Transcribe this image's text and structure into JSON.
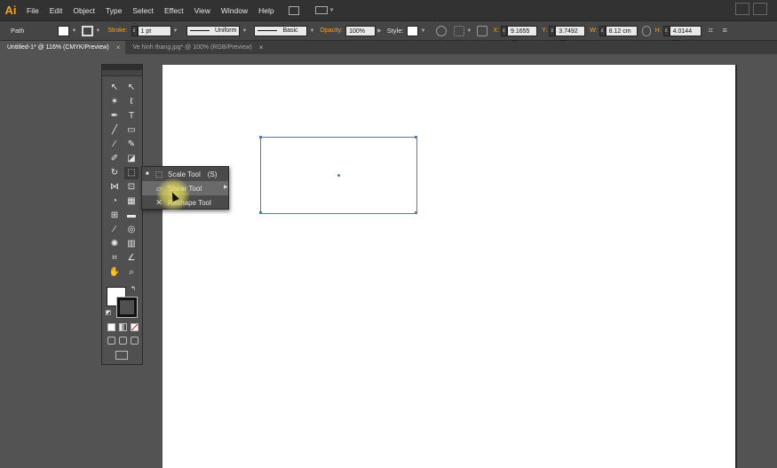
{
  "app": {
    "logo": "Ai"
  },
  "menu": {
    "items": [
      "File",
      "Edit",
      "Object",
      "Type",
      "Select",
      "Effect",
      "View",
      "Window",
      "Help"
    ]
  },
  "control_bar": {
    "selection_label": "Path",
    "fill_color": "#ffffff",
    "stroke_label": "Stroke:",
    "stroke_weight": "1 pt",
    "profile": "Uniform",
    "brush": "Basic",
    "opacity_label": "Opacity:",
    "opacity_value": "100%",
    "style_label": "Style:",
    "x_label": "X:",
    "x_value": "9.1655 cm",
    "y_label": "Y:",
    "y_value": "3.7492 cm",
    "w_label": "W:",
    "w_value": "8.12 cm",
    "h_label": "H:",
    "h_value": "4.0144 cm"
  },
  "tabs": [
    {
      "label": "Untitled-1* @ 116% (CMYK/Preview)",
      "active": true
    },
    {
      "label": "Ve hinh thang.jpg* @ 100% (RGB/Preview)",
      "active": false
    }
  ],
  "flyout": {
    "items": [
      {
        "label": "Scale Tool",
        "shortcut": "(S)",
        "icon": "scale-icon"
      },
      {
        "label": "Shear Tool",
        "shortcut": "",
        "icon": "shear-icon"
      },
      {
        "label": "Reshape Tool",
        "shortcut": "",
        "icon": "reshape-icon"
      }
    ]
  },
  "colors": {
    "accent": "#f7a21b",
    "selection": "#4f79c7",
    "cursor_highlight": "#ece25a"
  }
}
